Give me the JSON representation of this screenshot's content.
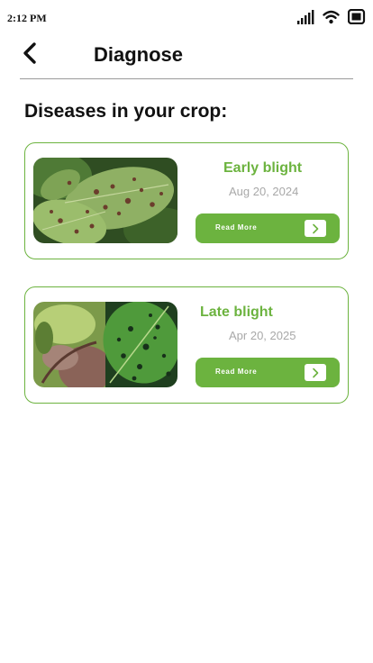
{
  "status_bar": {
    "time": "2:12 PM",
    "icons": [
      "signal-icon",
      "wifi-icon",
      "battery-icon"
    ]
  },
  "header": {
    "title": "Diagnose",
    "back_icon": "chevron-left-icon"
  },
  "section": {
    "title": "Diseases in your crop:"
  },
  "diseases": [
    {
      "name": "Early blight",
      "date": "Aug 20, 2024",
      "button_label": "Read More",
      "button_icon": "chevron-right-icon"
    },
    {
      "name": "Late blight",
      "date": "Apr 20, 2025",
      "button_label": "Read More",
      "button_icon": "chevron-right-icon"
    }
  ],
  "colors": {
    "accent": "#6cb33f",
    "date_text": "#a8a8a8",
    "divider": "#9a9a9a"
  }
}
